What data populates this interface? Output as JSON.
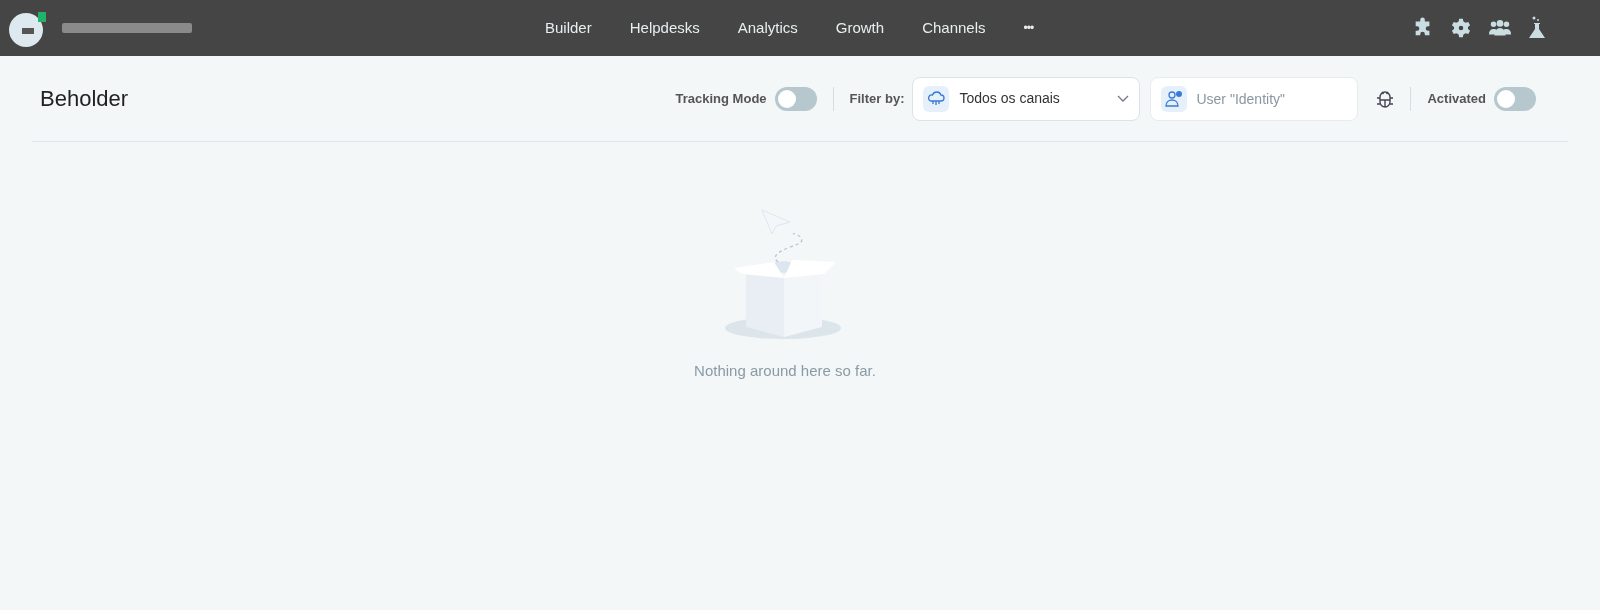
{
  "nav": [
    {
      "label": "Builder"
    },
    {
      "label": "Helpdesks"
    },
    {
      "label": "Analytics"
    },
    {
      "label": "Growth"
    },
    {
      "label": "Channels"
    }
  ],
  "nav_more": "•••",
  "page": {
    "title": "Beholder"
  },
  "tracking": {
    "label": "Tracking Mode",
    "on": false
  },
  "filter": {
    "label": "Filter by:",
    "value": "Todos os canais",
    "user_placeholder": "User \"Identity\""
  },
  "activated": {
    "label": "Activated",
    "on": false
  },
  "empty_message": "Nothing around here so far."
}
